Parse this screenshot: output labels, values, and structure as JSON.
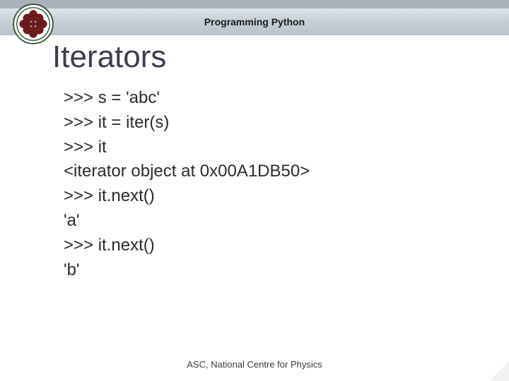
{
  "header": {
    "subtitle": "Programming Python"
  },
  "title": "Iterators",
  "code": {
    "l1": ">>> s = 'abc'",
    "l2": ">>> it = iter(s)",
    "l3": ">>> it",
    "l4": "<iterator object at 0x00A1DB50>",
    "l5": ">>> it.next()",
    "l6": "'a'",
    "l7": ">>> it.next()",
    "l8": "'b'"
  },
  "footer": "ASC, National Centre for Physics"
}
